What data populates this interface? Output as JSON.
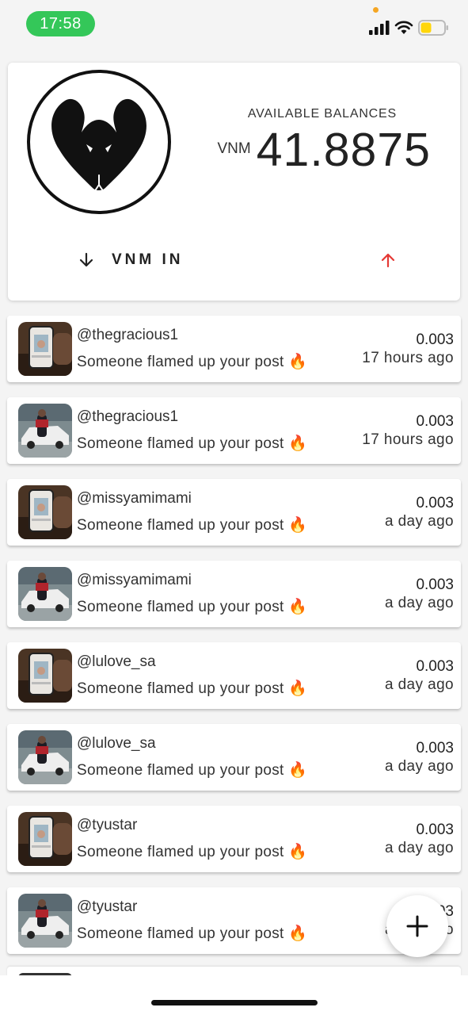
{
  "status_bar": {
    "time": "17:58"
  },
  "balance": {
    "label": "AVAILABLE BALANCES",
    "currency": "VNM",
    "amount": "41.8875",
    "in_label": "VNM IN"
  },
  "transactions": [
    {
      "user": "@thegracious1",
      "desc": "Someone flamed up your post",
      "emoji": "🔥",
      "amount": "0.003",
      "time": "17 hours ago",
      "thumb": "phone"
    },
    {
      "user": "@thegracious1",
      "desc": "Someone flamed up your post",
      "emoji": "🔥",
      "amount": "0.003",
      "time": "17 hours ago",
      "thumb": "car"
    },
    {
      "user": "@missyamimami",
      "desc": "Someone flamed up your post",
      "emoji": "🔥",
      "amount": "0.003",
      "time": "a day ago",
      "thumb": "phone"
    },
    {
      "user": "@missyamimami",
      "desc": "Someone flamed up your post",
      "emoji": "🔥",
      "amount": "0.003",
      "time": "a day ago",
      "thumb": "car"
    },
    {
      "user": "@lulove_sa",
      "desc": "Someone flamed up your post",
      "emoji": "🔥",
      "amount": "0.003",
      "time": "a day ago",
      "thumb": "phone"
    },
    {
      "user": "@lulove_sa",
      "desc": "Someone flamed up your post",
      "emoji": "🔥",
      "amount": "0.003",
      "time": "a day ago",
      "thumb": "car"
    },
    {
      "user": "@tyustar",
      "desc": "Someone flamed up your post",
      "emoji": "🔥",
      "amount": "0.003",
      "time": "a day ago",
      "thumb": "phone"
    },
    {
      "user": "@tyustar",
      "desc": "Someone flamed up your post",
      "emoji": "🔥",
      "amount": "0.003",
      "time": "a day ago",
      "thumb": "car"
    }
  ],
  "icons": {
    "logo": "snake-logo-icon",
    "in": "arrow-down-icon",
    "out": "arrow-up-icon",
    "fab": "plus-icon"
  },
  "colors": {
    "status_pill": "#34c759",
    "out_arrow": "#e53935",
    "battery": "#ffd60a"
  }
}
